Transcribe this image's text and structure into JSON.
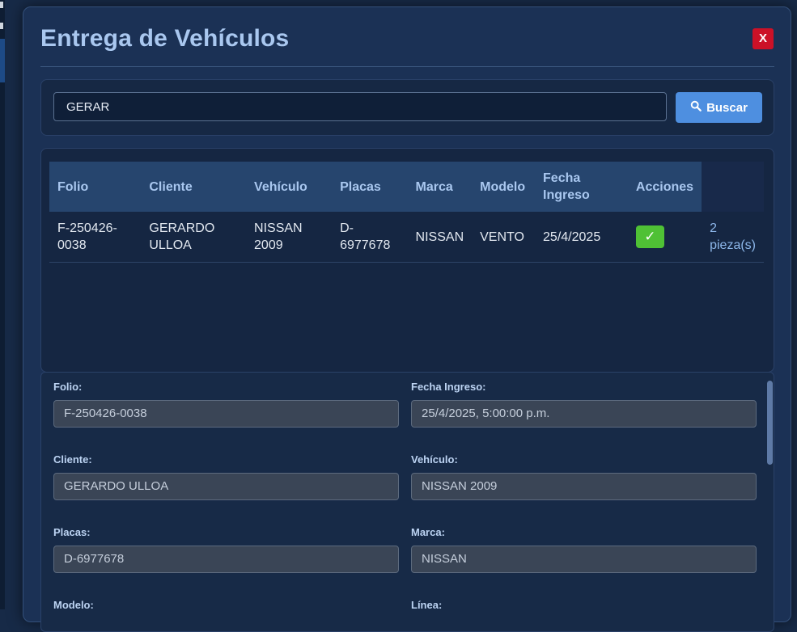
{
  "modal": {
    "title": "Entrega de Vehículos",
    "close_label": "X"
  },
  "search": {
    "value": "GERAR",
    "button_label": "Buscar"
  },
  "table": {
    "headers": [
      "Folio",
      "Cliente",
      "Vehículo",
      "Placas",
      "Marca",
      "Modelo",
      "Fecha Ingreso",
      "Acciones"
    ],
    "rows": [
      {
        "folio": "F-250426-0038",
        "cliente": "GERARDO ULLOA",
        "vehiculo": "NISSAN 2009",
        "placas": "D-6977678",
        "marca": "NISSAN",
        "modelo": "VENTO",
        "fecha": "25/4/2025",
        "action_label": "✓",
        "piezas": "2 pieza(s)"
      }
    ]
  },
  "details": {
    "folio": {
      "label": "Folio:",
      "value": "F-250426-0038"
    },
    "fecha_ingreso": {
      "label": "Fecha Ingreso:",
      "value": "25/4/2025, 5:00:00 p.m."
    },
    "cliente": {
      "label": "Cliente:",
      "value": "GERARDO ULLOA"
    },
    "vehiculo": {
      "label": "Vehículo:",
      "value": "NISSAN 2009"
    },
    "placas": {
      "label": "Placas:",
      "value": "D-6977678"
    },
    "marca": {
      "label": "Marca:",
      "value": "NISSAN"
    },
    "modelo": {
      "label": "Modelo:"
    },
    "linea": {
      "label": "Línea:"
    }
  },
  "colors": {
    "accent": "#4e8fe0",
    "danger": "#cc1127",
    "success": "#4fc135",
    "heading": "#a9c7ef"
  },
  "icons": {
    "search": "search-icon",
    "close": "close-icon",
    "check": "check-icon"
  }
}
